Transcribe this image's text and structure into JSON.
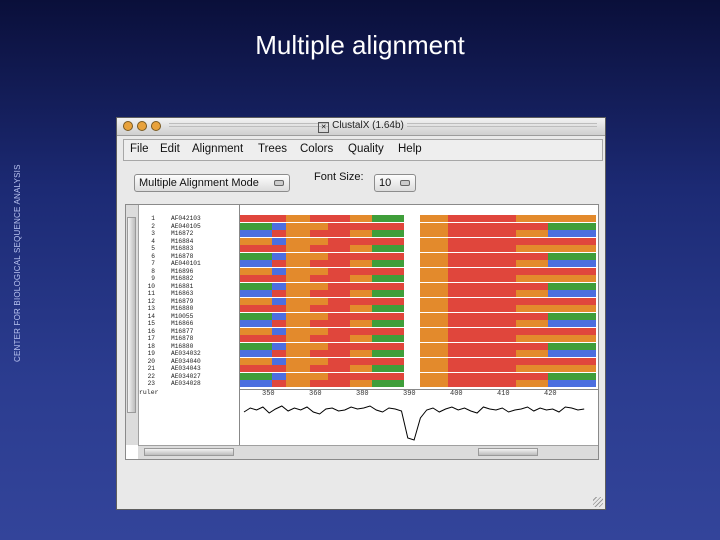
{
  "slide": {
    "title": "Multiple alignment",
    "side_label": "CENTER FOR BIOLOGICAL SEQUENCE ANALYSIS"
  },
  "window": {
    "title": "ClustalX (1.64b)"
  },
  "menu": [
    "File",
    "Edit",
    "Alignment",
    "Trees",
    "Colors",
    "Quality",
    "Help"
  ],
  "mode_select": {
    "value": "Multiple Alignment Mode"
  },
  "font_size": {
    "label": "Font Size:",
    "value": "10"
  },
  "sequences": [
    {
      "num": "1",
      "id": "AF042103"
    },
    {
      "num": "2",
      "id": "AE040105"
    },
    {
      "num": "3",
      "id": "M16872"
    },
    {
      "num": "4",
      "id": "M16884"
    },
    {
      "num": "5",
      "id": "M16883"
    },
    {
      "num": "6",
      "id": "M16878"
    },
    {
      "num": "7",
      "id": "AE040101"
    },
    {
      "num": "8",
      "id": "M16896"
    },
    {
      "num": "9",
      "id": "M16882"
    },
    {
      "num": "10",
      "id": "M16881"
    },
    {
      "num": "11",
      "id": "M16863"
    },
    {
      "num": "12",
      "id": "M16879"
    },
    {
      "num": "13",
      "id": "M16880"
    },
    {
      "num": "14",
      "id": "M10055"
    },
    {
      "num": "15",
      "id": "M16866"
    },
    {
      "num": "16",
      "id": "M16877"
    },
    {
      "num": "17",
      "id": "M16878"
    },
    {
      "num": "18",
      "id": "M16880"
    },
    {
      "num": "19",
      "id": "AE034032"
    },
    {
      "num": "20",
      "id": "AE034040"
    },
    {
      "num": "21",
      "id": "AE034043"
    },
    {
      "num": "22",
      "id": "AE034027"
    },
    {
      "num": "23",
      "id": "AE034028"
    }
  ],
  "consensus_label": "ruler",
  "ruler_ticks": [
    "350",
    "360",
    "380",
    "390",
    "400",
    "410",
    "420"
  ],
  "colors": {
    "A": "#e0463c",
    "T": "#3f9e3a",
    "G": "#e38a2c",
    "C": "#4c6fe0",
    "gap": "#ffffff"
  }
}
